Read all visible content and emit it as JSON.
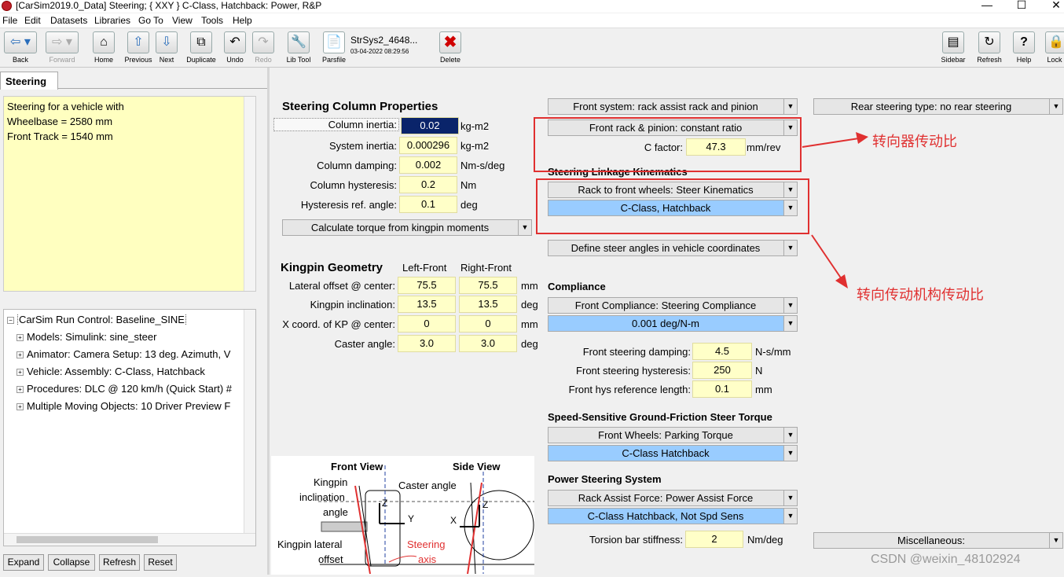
{
  "window": {
    "title": "[CarSim2019.0_Data] Steering; { XXY } C-Class, Hatchback: Power, R&P"
  },
  "menu": [
    "File",
    "Edit",
    "Datasets",
    "Libraries",
    "Go To",
    "View",
    "Tools",
    "Help"
  ],
  "toolbar": {
    "back": "Back",
    "forward": "Forward",
    "home": "Home",
    "previous": "Previous",
    "next": "Next",
    "duplicate": "Duplicate",
    "undo": "Undo",
    "redo": "Redo",
    "lib_tool": "Lib Tool",
    "parsfile": "Parsfile",
    "dataset_name": "StrSys2_4648...",
    "dataset_date": "03-04-2022 08:29:56",
    "delete": "Delete",
    "sidebar": "Sidebar",
    "refresh": "Refresh",
    "help": "Help",
    "lock": "Lock"
  },
  "tab": {
    "label": "Steering"
  },
  "notes": {
    "line1": "Steering for a vehicle with",
    "line2": "Wheelbase = 2580 mm",
    "line3": "Front Track =  1540 mm"
  },
  "tree": {
    "root": "CarSim Run Control: Baseline_SINE",
    "items": [
      "Models: Simulink: sine_steer",
      "Animator: Camera Setup: 13 deg. Azimuth, V",
      "Vehicle: Assembly: C-Class, Hatchback",
      "Procedures: DLC @ 120 km/h (Quick Start) #",
      "Multiple Moving Objects: 10 Driver Preview F"
    ],
    "buttons": {
      "expand": "Expand",
      "collapse": "Collapse",
      "refresh": "Refresh",
      "reset": "Reset"
    }
  },
  "column": {
    "heading": "Steering Column Properties",
    "rows": [
      {
        "label": "Column inertia:",
        "value": "0.02",
        "unit": "kg-m2"
      },
      {
        "label": "System inertia:",
        "value": "0.000296",
        "unit": "kg-m2"
      },
      {
        "label": "Column damping:",
        "value": "0.002",
        "unit": "Nm-s/deg"
      },
      {
        "label": "Column hysteresis:",
        "value": "0.2",
        "unit": "Nm"
      },
      {
        "label": "Hysteresis ref. angle:",
        "value": "0.1",
        "unit": "deg"
      }
    ],
    "calc_dropdown": "Calculate torque from kingpin moments"
  },
  "kingpin": {
    "heading": "Kingpin Geometry",
    "col_left": "Left-Front",
    "col_right": "Right-Front",
    "rows": [
      {
        "label": "Lateral offset @ center:",
        "left": "75.5",
        "right": "75.5",
        "unit": "mm"
      },
      {
        "label": "Kingpin inclination:",
        "left": "13.5",
        "right": "13.5",
        "unit": "deg"
      },
      {
        "label": "X coord. of KP @ center:",
        "left": "0",
        "right": "0",
        "unit": "mm"
      },
      {
        "label": "Caster angle:",
        "left": "3.0",
        "right": "3.0",
        "unit": "deg"
      }
    ]
  },
  "figure": {
    "front_view": "Front View",
    "side_view": "Side View",
    "kingpin": "Kingpin",
    "inclination": "inclination",
    "angle": "angle",
    "caster_angle": "Caster angle",
    "kingpin_lateral": "Kingpin lateral",
    "offset": "offset",
    "steering": "Steering",
    "axis": "axis",
    "z": "Z",
    "y": "Y",
    "x": "X"
  },
  "front": {
    "system_dd": "Front system: rack assist rack and pinion",
    "rack_dd": "Front rack & pinion: constant ratio",
    "c_factor_label": "C factor:",
    "c_factor_value": "47.3",
    "c_factor_unit": "mm/rev",
    "linkage_heading": "Steering Linkage Kinematics",
    "kin_dd": "Rack to front wheels: Steer Kinematics",
    "kin_dataset_dd": "C-Class, Hatchback",
    "define_dd": "Define steer angles in vehicle coordinates"
  },
  "rear": {
    "dd": "Rear steering type: no rear steering"
  },
  "compliance": {
    "heading": "Compliance",
    "dd": "Front Compliance: Steering Compliance",
    "dataset_dd": "0.001 deg/N-m",
    "rows": [
      {
        "label": "Front steering damping:",
        "value": "4.5",
        "unit": "N-s/mm"
      },
      {
        "label": "Front steering hysteresis:",
        "value": "250",
        "unit": "N"
      },
      {
        "label": "Front hys reference length:",
        "value": "0.1",
        "unit": "mm"
      }
    ]
  },
  "speed_sensitive": {
    "heading": "Speed-Sensitive Ground-Friction Steer Torque",
    "dd": "Front Wheels: Parking Torque",
    "dataset_dd": "C-Class Hatchback"
  },
  "power": {
    "heading": "Power Steering System",
    "dd": "Rack Assist Force: Power Assist Force",
    "dataset_dd": "C-Class Hatchback, Not Spd Sens",
    "torsion_label": "Torsion bar stiffness:",
    "torsion_value": "2",
    "torsion_unit": "Nm/deg"
  },
  "misc": {
    "dd": "Miscellaneous:"
  },
  "annotations": {
    "rack_ratio": "转向器传动比",
    "linkage_ratio": "转向传动机构传动比"
  },
  "watermark": "CSDN @weixin_48102924",
  "colors": {
    "annotation_red": "#e03030",
    "field_yellow": "#ffffc8",
    "dataset_blue": "#99ccff",
    "notes_yellow": "#ffffc0",
    "selected_navy": "#0a246a"
  }
}
